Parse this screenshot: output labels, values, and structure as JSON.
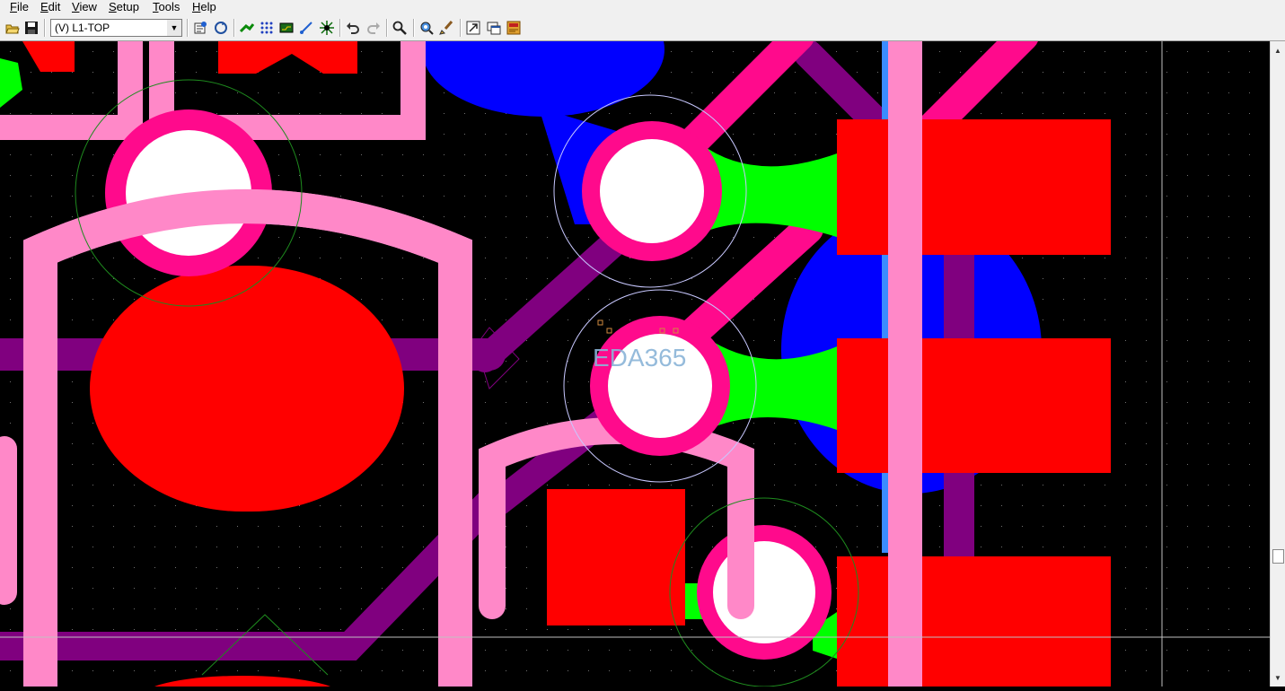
{
  "menu": [
    {
      "label": "File",
      "ul": "F",
      "rest": "ile"
    },
    {
      "label": "Edit",
      "ul": "E",
      "rest": "dit"
    },
    {
      "label": "View",
      "ul": "V",
      "rest": "iew"
    },
    {
      "label": "Setup",
      "ul": "S",
      "rest": "etup"
    },
    {
      "label": "Tools",
      "ul": "T",
      "rest": "ools"
    },
    {
      "label": "Help",
      "ul": "H",
      "rest": "elp"
    }
  ],
  "toolbar": {
    "layer_value": "(V) L1-TOP",
    "icons": [
      "open-icon",
      "save-icon",
      "properties-icon",
      "refresh-icon",
      "route-icon",
      "pattern-icon",
      "board-icon",
      "trace-icon",
      "via-icon",
      "undo-icon",
      "redo-icon",
      "zoom-icon",
      "view-icon",
      "brush-icon",
      "export-icon",
      "window-icon",
      "pdf-icon"
    ]
  },
  "canvas": {
    "watermark": "EDA365",
    "colors": {
      "background": "#000000",
      "top_copper": "#ff0000",
      "trace_pink": "#ff88c8",
      "trace_magenta": "#ff0a8c",
      "trace_purple": "#80007f",
      "pour_blue": "#0000ff",
      "thermal_green": "#00ff00",
      "via_hole": "#ffffff"
    }
  }
}
